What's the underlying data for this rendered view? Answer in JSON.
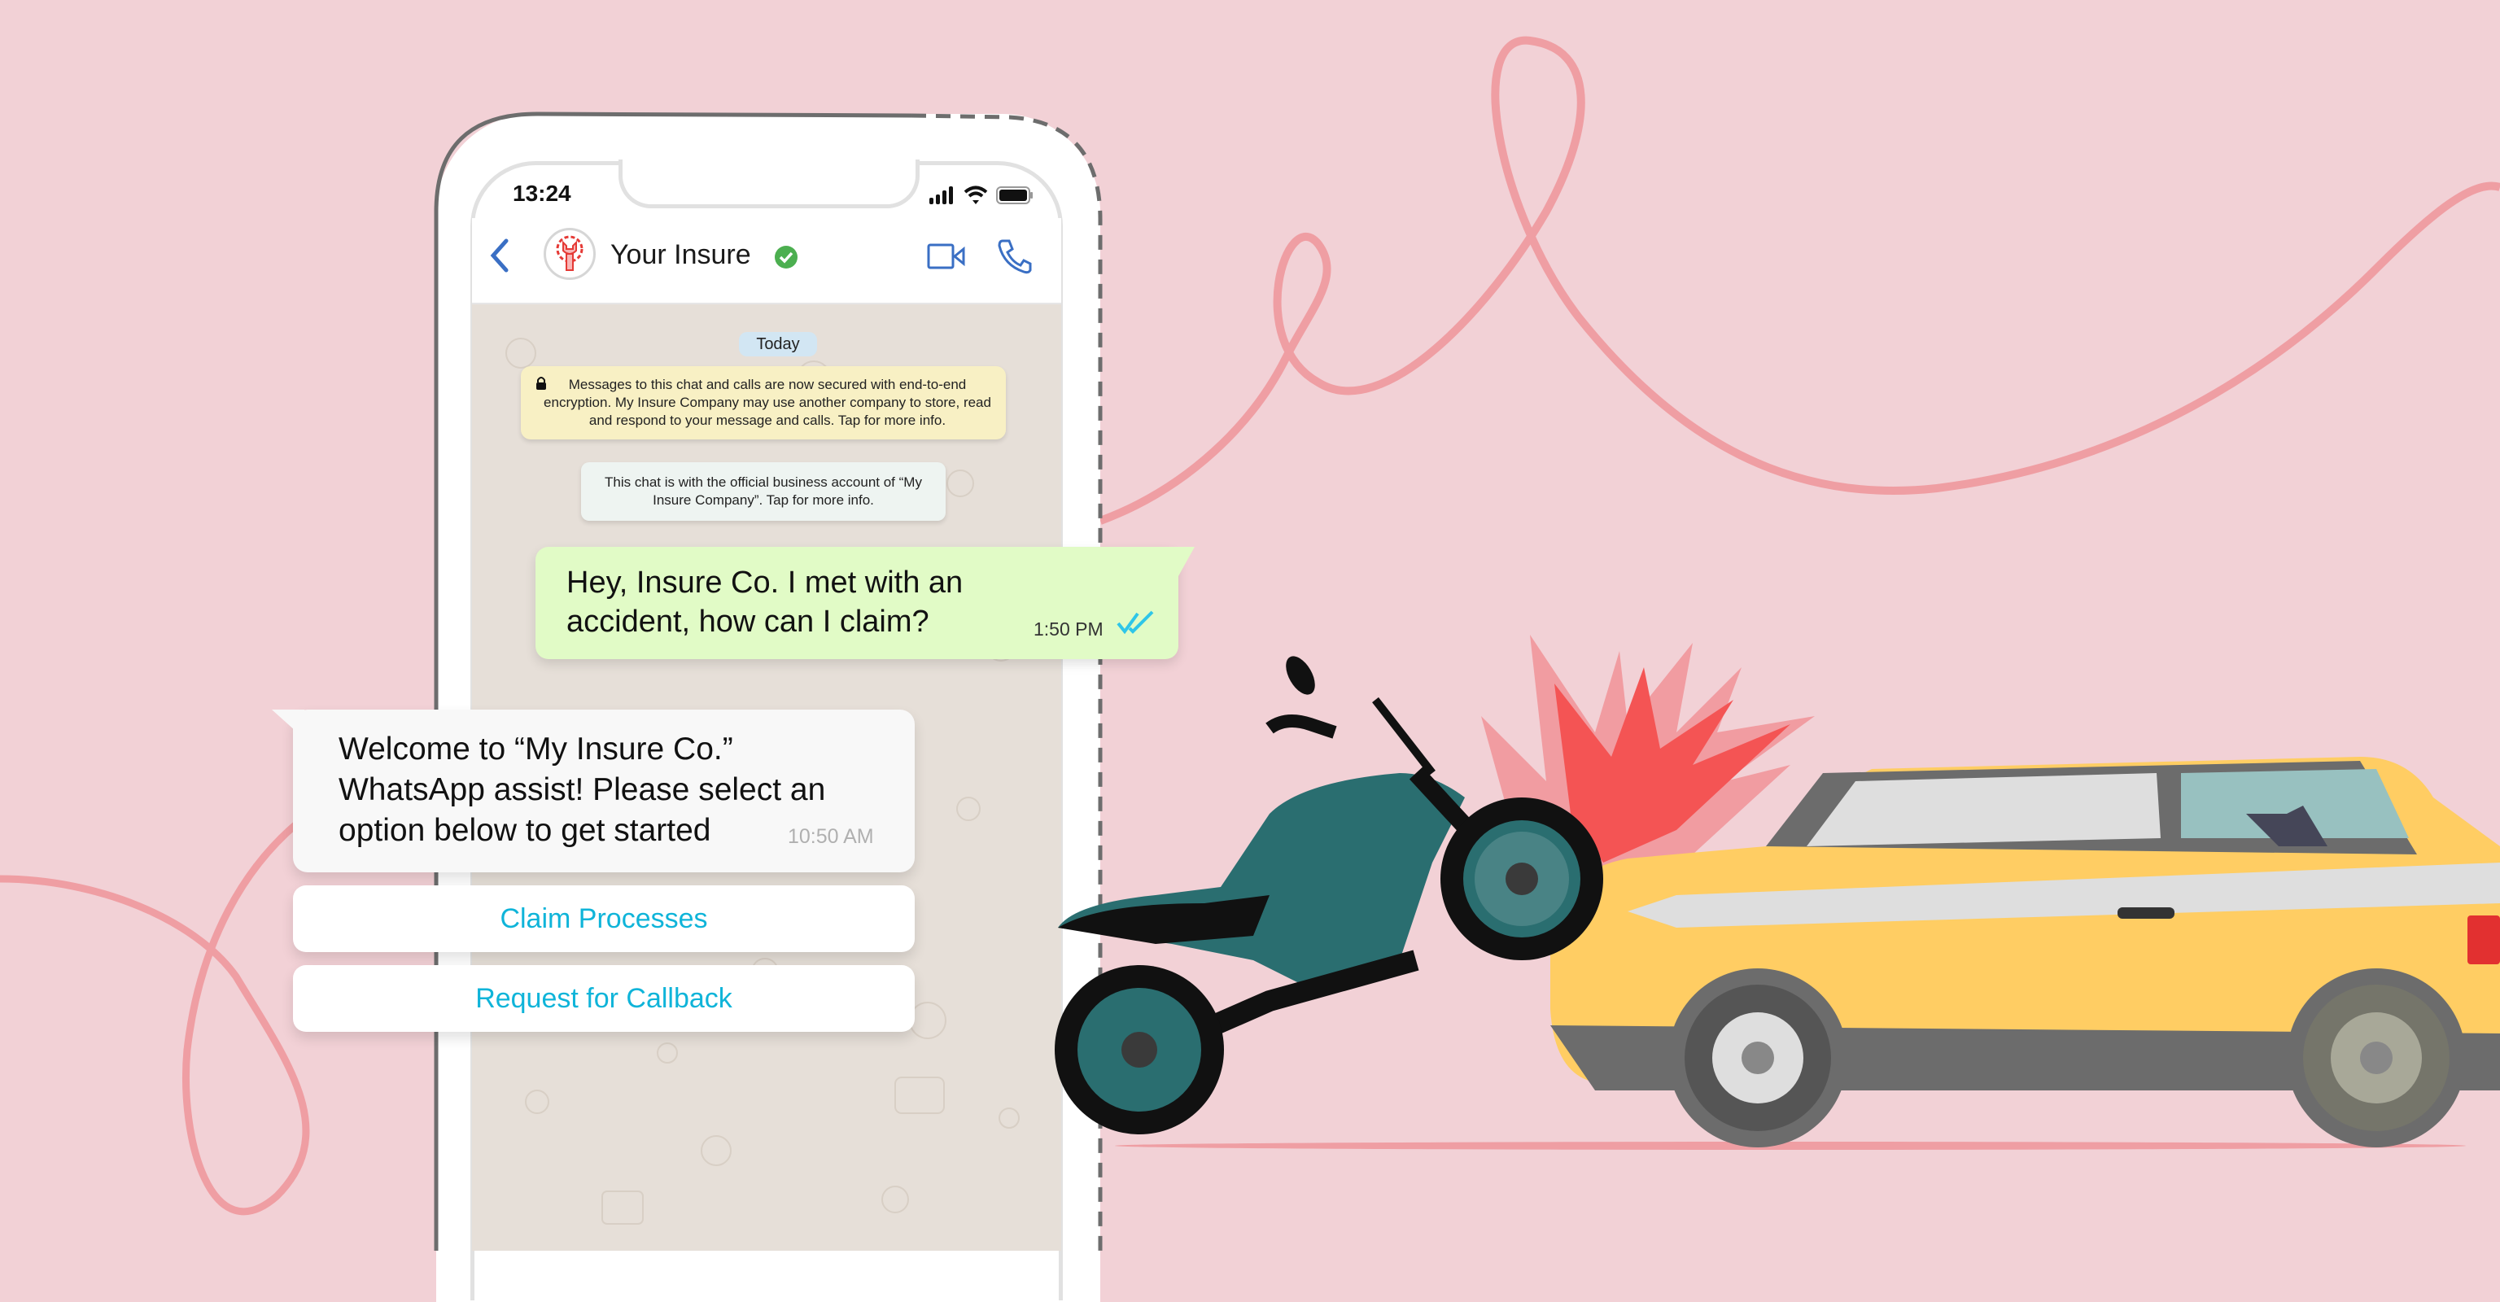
{
  "status_bar": {
    "time": "13:24",
    "icons": [
      "signal-icon",
      "wifi-icon",
      "battery-icon"
    ]
  },
  "chat_header": {
    "contact_name": "Your Insure",
    "verified": true,
    "actions": [
      "video-call",
      "voice-call"
    ]
  },
  "system_messages": {
    "date_chip": "Today",
    "encryption_notice": "Messages to this chat and calls are now secured with end-to-end encryption. My Insure Company may use another company to store, read and respond to your message and calls. Tap for more info.",
    "business_notice": "This chat is with the official business account of “My Insure Company”. Tap for more info."
  },
  "messages": [
    {
      "direction": "outgoing",
      "text": "Hey, Insure Co. I met with an accident, how can I claim?",
      "time": "1:50 PM",
      "status": "read"
    },
    {
      "direction": "incoming",
      "text": "Welcome to “My Insure Co.” WhatsApp assist! Please select an option below to get started",
      "time": "10:50 AM"
    }
  ],
  "quick_replies": [
    "Claim Processes",
    "Request for Callback"
  ],
  "colors": {
    "background": "#f2d1d6",
    "thread_line": "#ef9ea3",
    "outgoing_bubble": "#e1fbc6",
    "incoming_bubble": "#f8f8f8",
    "quick_reply_text": "#0fb4d9",
    "read_ticks": "#2fc6e8",
    "verified_badge": "#4caf50",
    "icon_blue": "#3a6fc4"
  },
  "illustration": {
    "description": "motorcycle crashing into yellow car with red impact burst"
  }
}
